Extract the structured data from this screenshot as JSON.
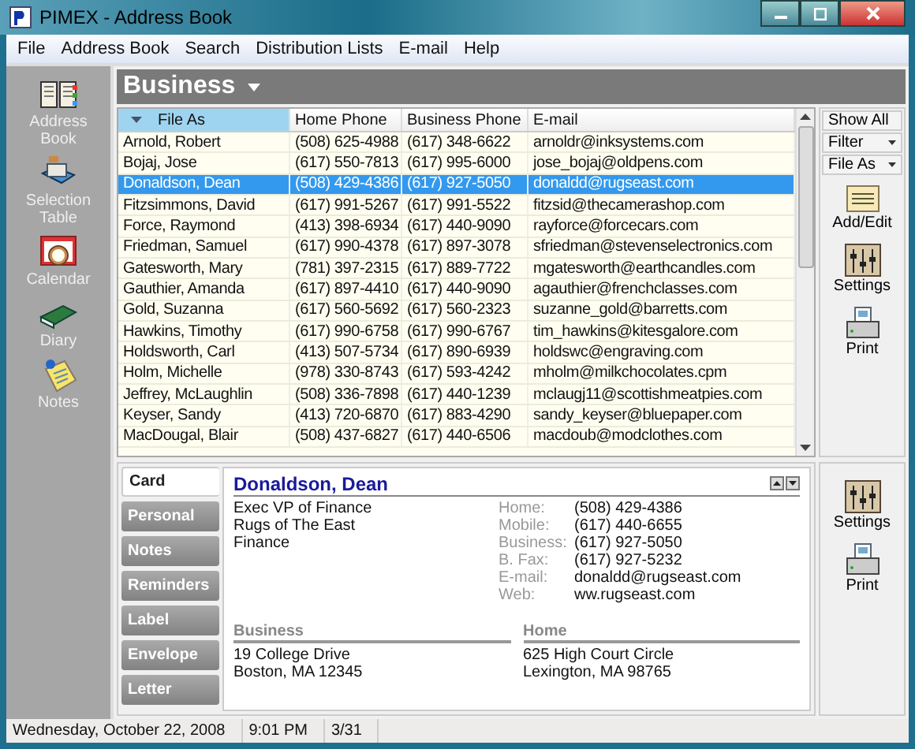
{
  "window": {
    "title": "PIMEX - Address Book"
  },
  "menu": [
    "File",
    "Address Book",
    "Search",
    "Distribution Lists",
    "E-mail",
    "Help"
  ],
  "nav": [
    {
      "label": "Address Book"
    },
    {
      "label": "Selection Table"
    },
    {
      "label": "Calendar"
    },
    {
      "label": "Diary"
    },
    {
      "label": "Notes"
    }
  ],
  "header": {
    "title": "Business"
  },
  "table": {
    "columns": [
      {
        "label": "File As",
        "sorted": true
      },
      {
        "label": "Home Phone",
        "sorted": false
      },
      {
        "label": "Business Phone",
        "sorted": false
      },
      {
        "label": "E-mail",
        "sorted": false
      }
    ],
    "rows": [
      {
        "cells": [
          "Arnold, Robert",
          "(508) 625-4988",
          "(617) 348-6622",
          "arnoldr@inksystems.com"
        ],
        "selected": false
      },
      {
        "cells": [
          "Bojaj, Jose",
          "(617) 550-7813",
          "(617) 995-6000",
          "jose_bojaj@oldpens.com"
        ],
        "selected": false
      },
      {
        "cells": [
          "Donaldson, Dean",
          "(508) 429-4386",
          "(617) 927-5050",
          "donaldd@rugseast.com"
        ],
        "selected": true
      },
      {
        "cells": [
          "Fitzsimmons, David",
          "(617) 991-5267",
          "(617) 991-5522",
          "fitzsid@thecamerashop.com"
        ],
        "selected": false
      },
      {
        "cells": [
          "Force, Raymond",
          "(413) 398-6934",
          "(617) 440-9090",
          "rayforce@forcecars.com"
        ],
        "selected": false
      },
      {
        "cells": [
          "Friedman, Samuel",
          "(617) 990-4378",
          "(617) 897-3078",
          "sfriedman@stevenselectronics.com"
        ],
        "selected": false
      },
      {
        "cells": [
          "Gatesworth, Mary",
          "(781) 397-2315",
          "(617) 889-7722",
          "mgatesworth@earthcandles.com"
        ],
        "selected": false
      },
      {
        "cells": [
          "Gauthier, Amanda",
          "(617) 897-4410",
          "(617) 440-9090",
          "agauthier@frenchclasses.com"
        ],
        "selected": false
      },
      {
        "cells": [
          "Gold, Suzanna",
          "(617) 560-5692",
          "(617) 560-2323",
          "suzanne_gold@barretts.com"
        ],
        "selected": false
      },
      {
        "cells": [
          "Hawkins, Timothy",
          "(617) 990-6758",
          "(617) 990-6767",
          "tim_hawkins@kitesgalore.com"
        ],
        "selected": false
      },
      {
        "cells": [
          "Holdsworth, Carl",
          "(413) 507-5734",
          "(617) 890-6939",
          "holdswc@engraving.com"
        ],
        "selected": false
      },
      {
        "cells": [
          "Holm, Michelle",
          "(978) 330-8743",
          "(617) 593-4242",
          "mholm@milkchocolates.cpm"
        ],
        "selected": false
      },
      {
        "cells": [
          "Jeffrey, McLaughlin",
          "(508) 336-7898",
          "(617) 440-1239",
          "mclaugj11@scottishmeatpies.com"
        ],
        "selected": false
      },
      {
        "cells": [
          "Keyser, Sandy",
          "(413) 720-6870",
          "(617) 883-4290",
          "sandy_keyser@bluepaper.com"
        ],
        "selected": false
      },
      {
        "cells": [
          "MacDougal, Blair",
          "(508) 437-6827",
          "(617) 440-6506",
          "macdoub@modclothes.com"
        ],
        "selected": false
      }
    ]
  },
  "list_tools": [
    {
      "label": "Show All",
      "kind": "button"
    },
    {
      "label": "Filter",
      "kind": "dropdown"
    },
    {
      "label": "File As",
      "kind": "dropdown"
    },
    {
      "label": "Add/Edit",
      "kind": "edit"
    },
    {
      "label": "Settings",
      "kind": "settings"
    },
    {
      "label": "Print",
      "kind": "print"
    }
  ],
  "detail_tabs": [
    {
      "label": "Card",
      "selected": true
    },
    {
      "label": "Personal",
      "selected": false
    },
    {
      "label": "Notes",
      "selected": false
    },
    {
      "label": "Reminders",
      "selected": false
    },
    {
      "label": "Label",
      "selected": false
    },
    {
      "label": "Envelope",
      "selected": false
    },
    {
      "label": "Letter",
      "selected": false
    }
  ],
  "card": {
    "name": "Donaldson, Dean",
    "lines": [
      "Exec VP of Finance",
      "Rugs of The East",
      "Finance"
    ],
    "fields": [
      {
        "label": "Home:",
        "value": "(508) 429-4386"
      },
      {
        "label": "Mobile:",
        "value": "(617) 440-6655"
      },
      {
        "label": "Business:",
        "value": "(617) 927-5050"
      },
      {
        "label": "B. Fax:",
        "value": "(617) 927-5232"
      },
      {
        "label": "E-mail:",
        "value": "donaldd@rugseast.com"
      },
      {
        "label": "Web:",
        "value": "ww.rugseast.com"
      }
    ],
    "addresses": [
      {
        "title": "Business",
        "lines": [
          "19 College Drive",
          "Boston, MA 12345"
        ]
      },
      {
        "title": "Home",
        "lines": [
          "625 High Court Circle",
          "Lexington, MA 98765"
        ]
      }
    ]
  },
  "detail_tools": [
    {
      "label": "Settings",
      "kind": "settings"
    },
    {
      "label": "Print",
      "kind": "print"
    }
  ],
  "status_bar": [
    "Wednesday, October 22, 2008",
    "9:01 PM",
    "3/31"
  ]
}
